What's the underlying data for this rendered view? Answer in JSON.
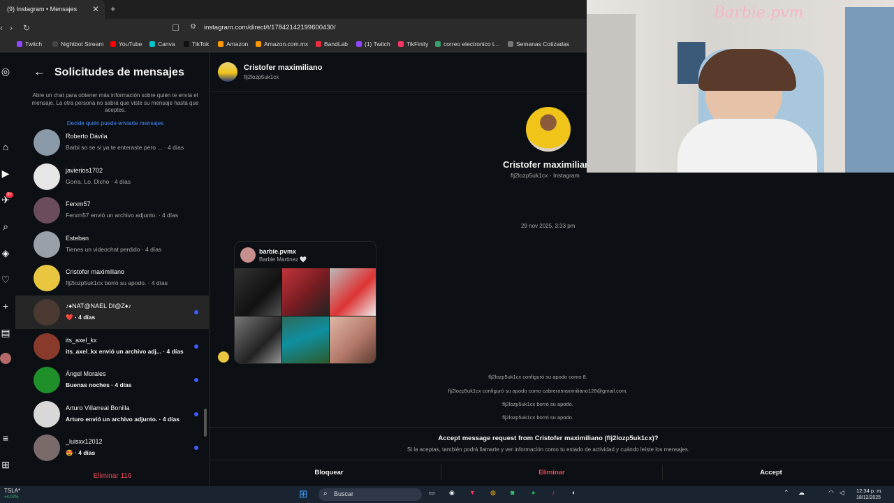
{
  "browser": {
    "tab_title": "(9) Instagram • Mensajes",
    "new_tab_symbol": "+",
    "url": "instagram.com/direct/t/17842142199600430/",
    "bookmarks": [
      {
        "label": "Twitch",
        "color": "#9146ff"
      },
      {
        "label": "Nightbot Stream",
        "color": "#444"
      },
      {
        "label": "YouTube",
        "color": "#ff0000"
      },
      {
        "label": "Canva",
        "color": "#00c4cc"
      },
      {
        "label": "TikTok",
        "color": "#111"
      },
      {
        "label": "Amazon",
        "color": "#ff9900"
      },
      {
        "label": "Amazon.com.mx",
        "color": "#ff9900"
      },
      {
        "label": "BandLab",
        "color": "#f12c3a"
      },
      {
        "label": "(1) Twitch",
        "color": "#9146ff"
      },
      {
        "label": "TikFinity",
        "color": "#ff3366"
      },
      {
        "label": "correo electronico t...",
        "color": "#3a9e6e"
      },
      {
        "label": "Semanas Cotizadas",
        "color": "#777"
      }
    ]
  },
  "rail": {
    "badge": "9+"
  },
  "panel": {
    "title": "Solicitudes de mensajes",
    "description": "Abre un chat para obtener más información sobre quién te envía el mensaje. La otra persona no sabrá que viste su mensaje hasta que aceptes.",
    "link": "Decide quién puede enviarte mensajes",
    "rows": [
      {
        "name": "Roberto Dávila",
        "sub": "Barbi so se si ya te enteraste pero ... · 4 días",
        "bold": false,
        "unread": false
      },
      {
        "name": "javierios1702",
        "sub": "Gorra. Lo. Dicho · 4 días",
        "bold": false,
        "unread": false
      },
      {
        "name": "Ferxm57",
        "sub": "Ferxm57 envió un archivo adjunto. · 4 días",
        "bold": false,
        "unread": false
      },
      {
        "name": "Esteban",
        "sub": "Tienes un videochat perdido · 4 días",
        "bold": false,
        "unread": false
      },
      {
        "name": "Cristofer maximiliano",
        "sub": "flj2lozp5uk1cx borró su apodo. · 4 días",
        "bold": false,
        "unread": false
      },
      {
        "name": "♪♦NAT@NAEL DI@Z♦♪",
        "sub": "❤️ · 4 días",
        "bold": true,
        "unread": true
      },
      {
        "name": "its_axel_kx",
        "sub": "its_axel_kx envió un archivo adj... · 4 días",
        "bold": true,
        "unread": true
      },
      {
        "name": "Ángel Morales",
        "sub": "Buenas noches · 4 días",
        "bold": true,
        "unread": true
      },
      {
        "name": "Arturo Villarreal Bonilla",
        "sub": "Arturo envió un archivo adjunto. · 4 días",
        "bold": true,
        "unread": true
      },
      {
        "name": "_luisxx12012",
        "sub": "😍 · 4 días",
        "bold": true,
        "unread": true
      }
    ],
    "delete_label": "Eliminar 116"
  },
  "conversation": {
    "header_name": "Cristofer maximiliano",
    "header_user": "flj2lozp5uk1cx",
    "profile_name": "Cristofer maximiliano",
    "profile_sub": "flj2lozp5uk1cx · Instagram",
    "timestamp": "29 nov 2025, 3:33 pm",
    "card_user": "barbie.pvmx",
    "card_name": "Barbie Martinez 🤍",
    "system_messages": [
      "flj2lozp5uk1cx configuró su apodo como 8.",
      "flj2lozp5uk1cx configuró su apodo como cabreramaximiliano128@gmail.com.",
      "flj2lozp5uk1cx borró su apodo.",
      "flj2lozp5uk1cx borró su apodo."
    ],
    "request_title": "Accept message request from Cristofer maximiliano (flj2lozp5uk1cx)?",
    "request_sub": "Si la aceptas, también podrá llamarte y ver información como tu estado de actividad y cuándo leíste los mensajes.",
    "block_label": "Bloquear",
    "delete_label": "Eliminar",
    "accept_label": "Accept"
  },
  "webcam": {
    "neon_text": "Barbie.pvm"
  },
  "taskbar": {
    "stock": "TSLA*",
    "stock_change": "+4.07%",
    "search": "Buscar",
    "time": "12:34 p. m.",
    "date": "18/12/2025"
  }
}
